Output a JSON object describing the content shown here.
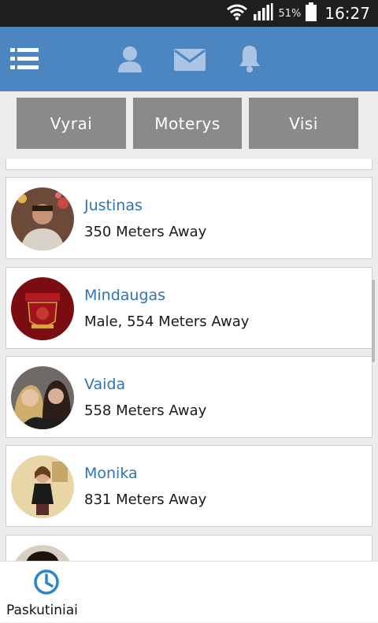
{
  "status_bar": {
    "battery_percent": "51%",
    "time": "16:27",
    "icons": [
      "wifi-icon",
      "signal-icon",
      "battery-icon"
    ]
  },
  "app_bar": {
    "icons": [
      "menu-icon",
      "profile-icon",
      "messages-icon",
      "notifications-icon"
    ],
    "background_color": "#4c86c0"
  },
  "filters": {
    "men_label": "Vyrai",
    "women_label": "Moterys",
    "all_label": "Visi",
    "button_color": "#8a8a8a"
  },
  "users": [
    {
      "name": "Justinas",
      "details": "350 Meters Away"
    },
    {
      "name": "Mindaugas",
      "details": "Male, 554 Meters Away"
    },
    {
      "name": "Vaida",
      "details": "558 Meters Away"
    },
    {
      "name": "Monika",
      "details": "831 Meters Away"
    }
  ],
  "bottom_nav": {
    "recent_label": "Paskutiniai",
    "recent_icon": "clock-icon"
  },
  "colors": {
    "name_text": "#2f74b5"
  }
}
